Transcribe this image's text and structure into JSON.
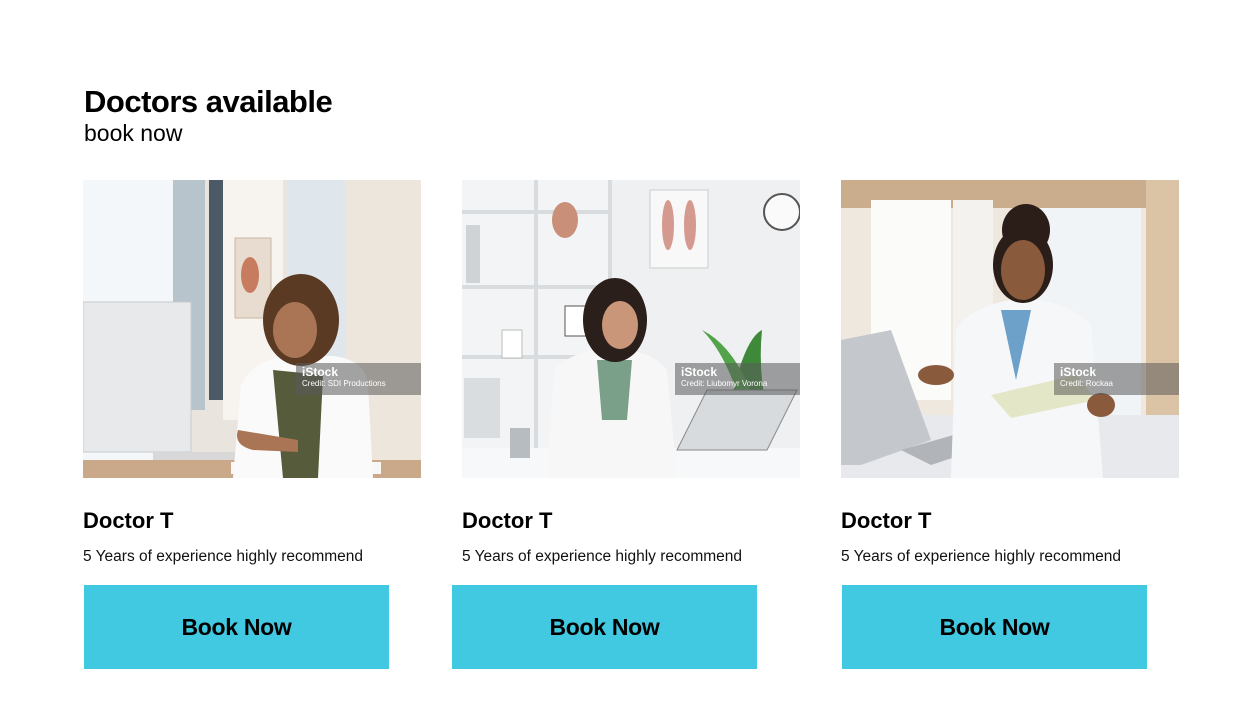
{
  "section": {
    "title": "Doctors available",
    "subtitle": "book now"
  },
  "doctors": [
    {
      "name": "Doctor T",
      "description": "5 Years of experience highly recommend",
      "button_label": "Book Now",
      "watermark_brand": "iStock",
      "watermark_credit": "Credit: SDI Productions"
    },
    {
      "name": "Doctor T",
      "description": "5 Years of experience highly recommend",
      "button_label": "Book Now",
      "watermark_brand": "iStock",
      "watermark_credit": "Credit: Liubomyr Vorona"
    },
    {
      "name": "Doctor T",
      "description": "5 Years of experience highly recommend",
      "button_label": "Book Now",
      "watermark_brand": "iStock",
      "watermark_credit": "Credit: Rockaa"
    }
  ],
  "colors": {
    "button_bg": "#40c9e0",
    "text": "#000000",
    "background": "#ffffff"
  }
}
